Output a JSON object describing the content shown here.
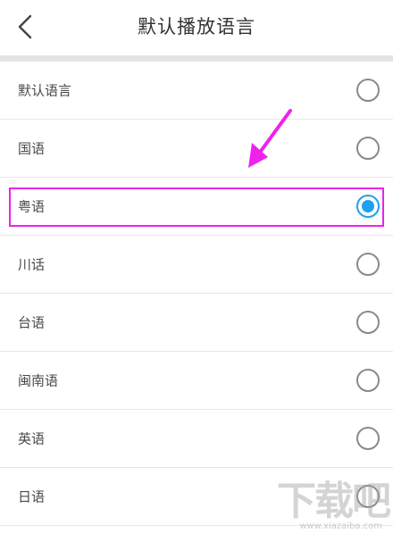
{
  "header": {
    "title": "默认播放语言",
    "back_icon": "chevron-left-icon"
  },
  "languages": [
    {
      "label": "默认语言",
      "selected": false
    },
    {
      "label": "国语",
      "selected": false
    },
    {
      "label": "粤语",
      "selected": true
    },
    {
      "label": "川话",
      "selected": false
    },
    {
      "label": "台语",
      "selected": false
    },
    {
      "label": "闽南语",
      "selected": false
    },
    {
      "label": "英语",
      "selected": false
    },
    {
      "label": "日语",
      "selected": false
    }
  ],
  "colors": {
    "radio_selected": "#1ea0f0",
    "annotation": "#ee22ee"
  },
  "watermark": {
    "text": "下载吧",
    "url": "www.xiazaiba.com"
  }
}
